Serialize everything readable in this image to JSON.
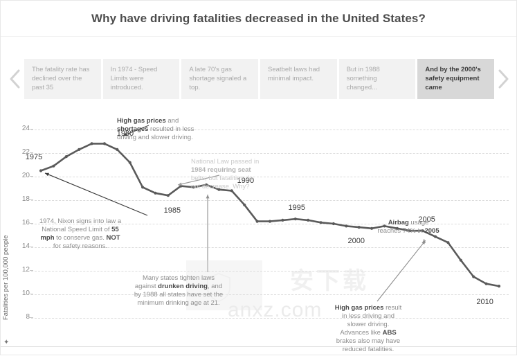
{
  "header": {
    "title": "Why have driving fatalities decreased in the United States?"
  },
  "story_nav": {
    "prev_icon": "chevron-left-icon",
    "next_icon": "chevron-right-icon",
    "items": [
      {
        "label": "The fatality rate has declined over the past 35",
        "active": false
      },
      {
        "label": "In 1974 - Speed Limits were introduced.",
        "active": false
      },
      {
        "label": "A late 70's gas shortage signaled a top.",
        "active": false
      },
      {
        "label": "Seatbelt laws had minimal impact.",
        "active": false
      },
      {
        "label": "But in 1988 something changed...",
        "active": false
      },
      {
        "label": "And by the 2000's safety equipment came",
        "active": true
      }
    ]
  },
  "chart_data": {
    "type": "line",
    "title": "Why have driving fatalities decreased in the United States?",
    "xlabel": "",
    "ylabel": "Fatalities per 100,000 people",
    "ylim": [
      8,
      24
    ],
    "yticks": [
      24,
      22,
      20,
      18,
      16,
      14,
      12,
      10,
      8
    ],
    "xlim": [
      1975,
      2011
    ],
    "grid": true,
    "legend": "none",
    "x": [
      1975,
      1976,
      1977,
      1978,
      1979,
      1980,
      1981,
      1982,
      1983,
      1984,
      1985,
      1986,
      1987,
      1988,
      1989,
      1990,
      1991,
      1992,
      1993,
      1994,
      1995,
      1996,
      1997,
      1998,
      1999,
      2000,
      2001,
      2002,
      2003,
      2004,
      2005,
      2006,
      2007,
      2008,
      2009,
      2010,
      2011
    ],
    "values": [
      20.5,
      20.9,
      21.7,
      22.3,
      22.8,
      22.8,
      22.3,
      21.2,
      19.1,
      18.6,
      18.4,
      19.2,
      19.1,
      19.3,
      18.9,
      18.8,
      17.6,
      16.2,
      16.2,
      16.3,
      16.4,
      16.3,
      16.1,
      16.0,
      15.8,
      15.7,
      15.6,
      15.8,
      15.6,
      15.4,
      15.4,
      14.9,
      14.4,
      12.9,
      11.5,
      10.9,
      10.7
    ],
    "point_labels": [
      {
        "year": 1975,
        "text": "1975"
      },
      {
        "year": 1980,
        "text": "1980"
      },
      {
        "year": 1985,
        "text": "1985"
      },
      {
        "year": 1990,
        "text": "1990"
      },
      {
        "year": 1995,
        "text": "1995"
      },
      {
        "year": 2000,
        "text": "2000"
      },
      {
        "year": 2005,
        "text": "2005"
      },
      {
        "year": 2010,
        "text": "2010"
      }
    ],
    "annotations": [
      {
        "id": "gas-prices-1979",
        "text": "High gas prices and shortages resulted in less driving and slower driving.",
        "bold": [
          "High gas prices",
          "shortages"
        ]
      },
      {
        "id": "nixon-1974",
        "text": "1974, Nixon signs into law a National Speed Limit of 55 mph to conserve gas.  NOT for safety reasons.",
        "bold": [
          "55 mph",
          "NOT"
        ]
      },
      {
        "id": "seatbelt-1984",
        "text": "National Law passed in 1984 requiring seat belts, but fatalities do not decrease.  Why?",
        "bold": []
      },
      {
        "id": "drunken-driving-1988",
        "text": "Many states tighten laws against drunken driving, and by 1988 all states have set the minimum drinking age at 21.",
        "bold": [
          "drunken driving"
        ]
      },
      {
        "id": "airbag-2005",
        "text": "Airbag usage reaches 74% in 2005",
        "bold": [
          "Airbag",
          "2005"
        ]
      },
      {
        "id": "gas-prices-2008",
        "text": "High gas prices result in less driving and slower driving. Advances like ABS brakes also may have reduced fatalities.",
        "bold": [
          "High gas prices",
          "ABS"
        ]
      }
    ]
  },
  "annotations_rendered": {
    "gas_prices_1979": {
      "l1_bold": "High gas prices",
      "l1_rest": " and",
      "l2_bold": "shortages",
      "l2_rest": " resulted in less",
      "l3": "driving and slower driving."
    },
    "nixon_1974": {
      "l1": "1974, Nixon signs into law a",
      "l2": "National Speed Limit of ",
      "l2_bold": "55",
      "l3_bold": "mph",
      "l3_rest": " to conserve gas.  ",
      "l3_bold2": "NOT",
      "l4": "for safety reasons."
    },
    "seatbelt_1984": {
      "l1": "National Law passed in",
      "l2": "1984 requiring seat",
      "l3": "belts, but fatalities do",
      "l4": "not decrease.  Why?"
    },
    "drunken_driving": {
      "l1": "Many states tighten laws",
      "l2_pre": "against ",
      "l2_bold": "drunken driving",
      "l2_post": ", and",
      "l3": "by 1988 all states have set the",
      "l4": "minimum drinking age at 21."
    },
    "airbag_2005": {
      "l1_bold": "Airbag",
      "l1_rest": " usage",
      "l2_pre": "reaches 74% in ",
      "l2_bold": "2005"
    },
    "gas_prices_2008": {
      "l1_bold": "High gas prices",
      "l1_rest": " result",
      "l2": "in less driving and",
      "l3": "slower driving.",
      "l4_pre": "Advances like ",
      "l4_bold": "ABS",
      "l5": "brakes also may have",
      "l6": "reduced fatalities."
    }
  },
  "watermark": {
    "text": "anxz.com",
    "cjk": "安下载"
  },
  "colors": {
    "line": "#5a5a5a",
    "grid": "#dcdcdc",
    "nav_inactive_bg": "#f2f2f2",
    "nav_active_bg": "#d8d8d8",
    "title": "#4d4d4d"
  }
}
